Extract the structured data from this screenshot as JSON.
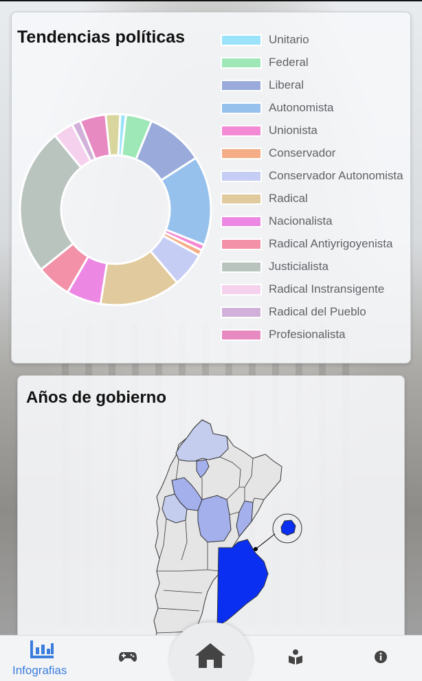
{
  "charts": {
    "title": "Tendencias políticas",
    "chart_data": {
      "type": "pie",
      "categories": [
        "Unitario",
        "Federal",
        "Liberal",
        "Autonomista",
        "Unionista",
        "Conservador",
        "Conservador Autonomista",
        "Radical",
        "Nacionalista",
        "Radical Antiyrigoyenista",
        "Justicialista",
        "Radical Instransigente",
        "Radical del Pueblo",
        "Profesionalista"
      ],
      "values": [
        1.0,
        4.5,
        10.0,
        15.5,
        1.0,
        1.0,
        6.0,
        14.0,
        6.0,
        6.0,
        25.5,
        3.5,
        1.5,
        4.5,
        2.5
      ],
      "colors": [
        "#9be3fa",
        "#9ee8b8",
        "#9aabdb",
        "#96c1ec",
        "#f58ad4",
        "#f4ad86",
        "#c5cdf4",
        "#e1ca9d",
        "#ec88e4",
        "#f291a7",
        "#bac4bf",
        "#f5d1ee",
        "#d1b1d9",
        "#e88ac2",
        "#d8d69c"
      ],
      "legend": "right"
    },
    "legend_colors": [
      "#9be3fa",
      "#9ee8b8",
      "#9aabdb",
      "#96c1ec",
      "#f58ad4",
      "#f4ad86",
      "#c5cdf4",
      "#e1ca9d",
      "#ec88e4",
      "#f291a7",
      "#bac4bf",
      "#f5d1ee",
      "#d1b1d9",
      "#e88ac2"
    ]
  },
  "map": {
    "title": "Años de gobierno",
    "colors": {
      "base": "#e5e5e5",
      "light": "#c4cdee",
      "medium": "#a3b0ec",
      "strong": "#0a2ff0",
      "border": "#333333"
    }
  },
  "nav": {
    "infographics_label": "Infografias",
    "active_color": "#3b7ddd",
    "icons": [
      "bar-chart-icon",
      "gamepad-icon",
      "home-icon",
      "book-reader-icon",
      "info-icon"
    ]
  }
}
